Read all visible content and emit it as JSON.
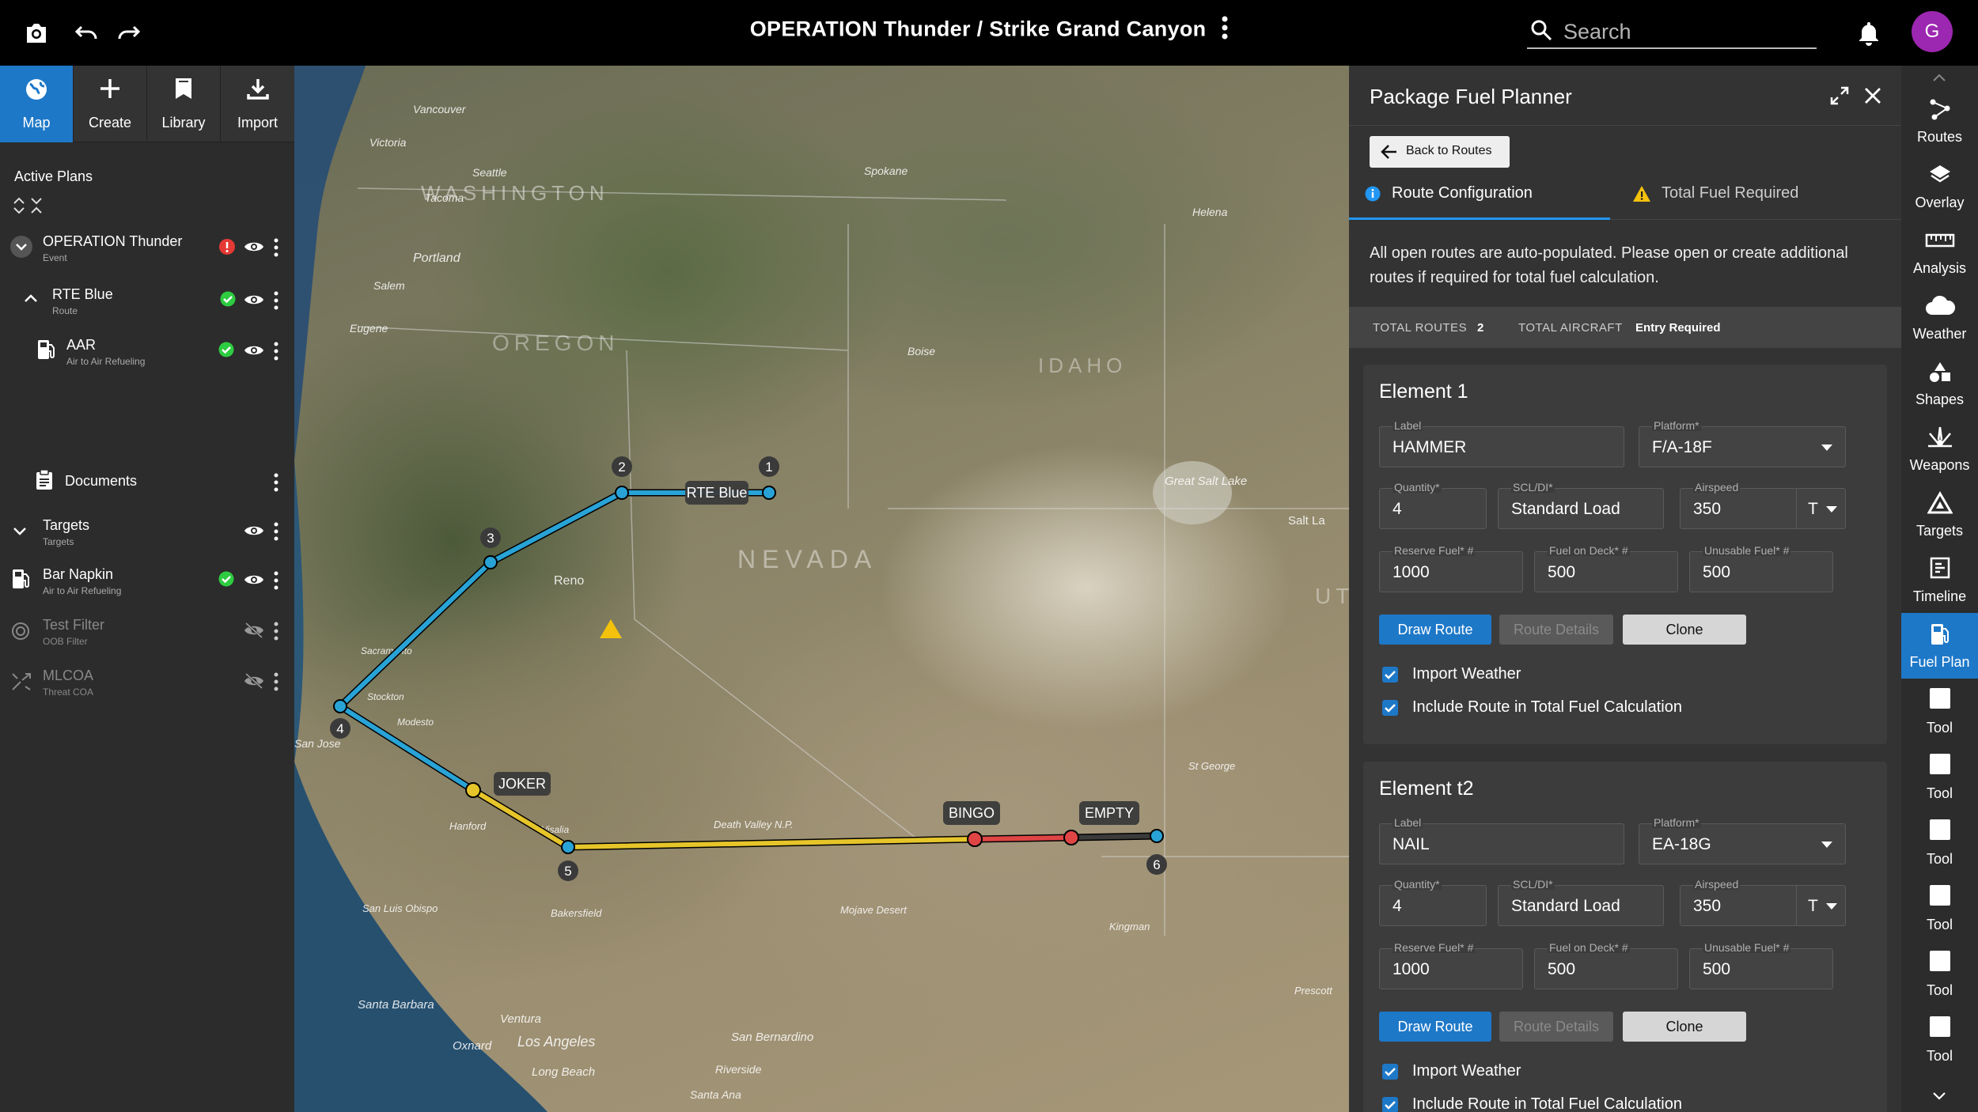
{
  "topbar": {
    "title": "OPERATION Thunder / Strike Grand Canyon",
    "search_placeholder": "Search",
    "avatar_initial": "G"
  },
  "left_nav": {
    "tabs": [
      {
        "label": "Map",
        "icon": "globe-icon",
        "active": true
      },
      {
        "label": "Create",
        "icon": "plus-icon"
      },
      {
        "label": "Library",
        "icon": "bookmark-icon"
      },
      {
        "label": "Import",
        "icon": "download-icon"
      }
    ],
    "section_title": "Active Plans",
    "plans": [
      {
        "title": "OPERATION Thunder",
        "subtitle": "Event",
        "status": "error"
      },
      {
        "title": "RTE Blue",
        "subtitle": "Route",
        "status": "ok"
      },
      {
        "title": "AAR",
        "subtitle": "Air to Air Refueling",
        "status": "ok"
      },
      {
        "title": "Documents",
        "subtitle": ""
      },
      {
        "title": "Targets",
        "subtitle": "Targets"
      },
      {
        "title": "Bar Napkin",
        "subtitle": "Air to Air Refueling",
        "status": "ok"
      },
      {
        "title": "Test Filter",
        "subtitle": "OOB Filter",
        "hidden": true
      },
      {
        "title": "MLCOA",
        "subtitle": "Threat COA",
        "hidden": true
      }
    ]
  },
  "map": {
    "labels": {
      "washington": "WASHINGTON",
      "oregon": "OREGON",
      "idaho": "IDAHO",
      "nevada": "NEVADA",
      "utah": "UTA",
      "vancouver": "Vancouver",
      "victoria": "Victoria",
      "seattle": "Seattle",
      "tacoma": "Tacoma",
      "spokane": "Spokane",
      "helena": "Helena",
      "portland": "Portland",
      "salem": "Salem",
      "eugene": "Eugene",
      "boise": "Boise",
      "great_salt_lake": "Great Salt Lake",
      "salt_lake": "Salt La",
      "reno": "Reno",
      "sacramento": "Sacramento",
      "stockton": "Stockton",
      "modesto": "Modesto",
      "san_jose": "San Jose",
      "fresno": "Visalia",
      "hanford": "Hanford",
      "bakersfield": "Bakersfield",
      "san_luis_obispo": "San Luis Obispo",
      "santa_barbara": "Santa Barbara",
      "ventura": "Ventura",
      "oxnard": "Oxnard",
      "los_angeles": "Los Angeles",
      "long_beach": "Long Beach",
      "san_bernardino": "San Bernardino",
      "riverside": "Riverside",
      "santa_ana": "Santa Ana",
      "kingman": "Kingman",
      "prescott": "Prescott",
      "st_george": "St George",
      "mojave": "Mojave Desert",
      "death_valley": "Death Valley N.P."
    },
    "route_label": "RTE Blue",
    "waypoints": [
      "1",
      "2",
      "3",
      "4",
      "5",
      "6"
    ],
    "markers": {
      "joker": "JOKER",
      "bingo": "BINGO",
      "empty": "EMPTY"
    }
  },
  "panel": {
    "title": "Package Fuel Planner",
    "back_label": "Back to Routes",
    "tabs": [
      {
        "label": "Route Configuration",
        "active": true
      },
      {
        "label": "Total Fuel Required"
      }
    ],
    "notice": "All open routes are auto-populated. Please open or create additional routes if required for total fuel calculation.",
    "totals": {
      "routes_label": "TOTAL ROUTES",
      "routes_value": "2",
      "aircraft_label": "TOTAL AIRCRAFT",
      "aircraft_value": "Entry Required"
    },
    "field_labels": {
      "label": "Label",
      "platform": "Platform*",
      "quantity": "Quantity*",
      "scl": "SCL/DI*",
      "airspeed": "Airspeed",
      "reserve": "Reserve Fuel* #",
      "fuel_on_deck": "Fuel on Deck* #",
      "unusable": "Unusable Fuel* #"
    },
    "buttons": {
      "draw": "Draw Route",
      "details": "Route Details",
      "clone": "Clone"
    },
    "checks": {
      "weather": "Import Weather",
      "include": "Include Route in Total Fuel Calculation"
    },
    "elements": [
      {
        "title": "Element 1",
        "label": "HAMMER",
        "platform": "F/A-18F",
        "quantity": "4",
        "scl": "Standard Load",
        "airspeed": "350",
        "airspeed_unit": "T",
        "reserve": "1000",
        "fuel_on_deck": "500",
        "unusable": "500"
      },
      {
        "title": "Element t2",
        "label": "NAIL",
        "platform": "EA-18G",
        "quantity": "4",
        "scl": "Standard Load",
        "airspeed": "350",
        "airspeed_unit": "T",
        "reserve": "1000",
        "fuel_on_deck": "500",
        "unusable": "500"
      }
    ]
  },
  "right_tools": [
    {
      "label": "Routes",
      "icon": "routes-icon"
    },
    {
      "label": "Overlay",
      "icon": "layers-icon"
    },
    {
      "label": "Analysis",
      "icon": "ruler-icon"
    },
    {
      "label": "Weather",
      "icon": "cloud-icon"
    },
    {
      "label": "Shapes",
      "icon": "shapes-icon"
    },
    {
      "label": "Weapons",
      "icon": "weapons-icon"
    },
    {
      "label": "Targets",
      "icon": "target-triangle-icon"
    },
    {
      "label": "Timeline",
      "icon": "timeline-icon"
    },
    {
      "label": "Fuel Plan",
      "icon": "fuel-pump-icon",
      "active": true
    },
    {
      "label": "Tool",
      "icon": "tool-icon"
    },
    {
      "label": "Tool",
      "icon": "tool-icon"
    },
    {
      "label": "Tool",
      "icon": "tool-icon"
    },
    {
      "label": "Tool",
      "icon": "tool-icon"
    },
    {
      "label": "Tool",
      "icon": "tool-icon"
    },
    {
      "label": "Tool",
      "icon": "tool-icon"
    }
  ],
  "colors": {
    "accent": "#1e78c8",
    "route_blue": "#29a3d6",
    "route_yellow": "#e6c52a",
    "route_red": "#e04545",
    "ok": "#2ecc40",
    "error": "#e53935",
    "avatar": "#9c27b0"
  }
}
